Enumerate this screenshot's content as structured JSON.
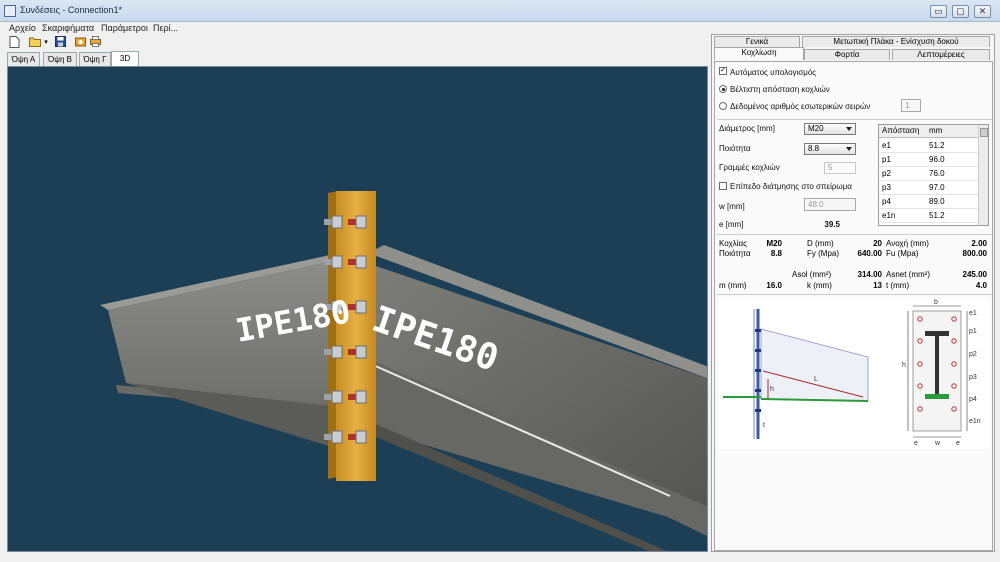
{
  "window": {
    "title": "Συνδέσεις - Connection1*",
    "min": "▭",
    "max": "▢",
    "close": "✕"
  },
  "menu": [
    "Αρχείο",
    "Σκαριφήματα",
    "Παράμετροι",
    "Περί..."
  ],
  "toolbar": {
    "icons": [
      "new-icon",
      "open-icon",
      "save-icon",
      "snapshot-icon",
      "print-icon"
    ]
  },
  "view_tabs": [
    "Όψη Α",
    "Όψη Β",
    "Όψη Γ",
    "3D"
  ],
  "view3d": {
    "beam_label_left": "IPE180",
    "beam_label_right": "IPE180"
  },
  "right_tabs_row1": [
    "Γενικά",
    "Μετωπική Πλάκα - Ενίσχυση δοκού"
  ],
  "right_tabs_row2": [
    "Κοχλίωση",
    "Φορτία",
    "Λεπτομέρειες"
  ],
  "bolting": {
    "auto_calc": "Αυτόματος υπολογισμός",
    "option_optimal": "Βέλτιστη απόσταση κοχλιών",
    "option_given": "Δεδομένος αριθμός εσωτερικών σειρών",
    "given_rows_value": "1",
    "diameter_label": "Διάμετρος [mm]",
    "diameter_value": "M20",
    "quality_label": "Ποιότητα",
    "quality_value": "8.8",
    "rows_label": "Γραμμές κοχλιών",
    "rows_value": "5",
    "threaded_plane": "Επίπεδο διάτμησης στο σπείρωμα",
    "w_label": "w [mm]",
    "w_value": "48.0",
    "e_label": "e [mm]",
    "e_value": "39.5",
    "table_headers": [
      "Απόσταση",
      "mm"
    ],
    "table_rows": [
      [
        "e1",
        "51.2"
      ],
      [
        "p1",
        "96.0"
      ],
      [
        "p2",
        "76.0"
      ],
      [
        "p3",
        "97.0"
      ],
      [
        "p4",
        "89.0"
      ],
      [
        "e1n",
        "51.2"
      ]
    ]
  },
  "results": {
    "bolt_label": "Κοχλίας",
    "bolt_value": "M20",
    "quality_label": "Ποιότητα",
    "quality_value": "8.8",
    "D_label": "D (mm)",
    "D_value": "20",
    "Fy_label": "Fy (Mpa)",
    "Fy_value": "640.00",
    "tol_label": "Ανοχή (mm)",
    "tol_value": "2.00",
    "Fu_label": "Fu (Mpa)",
    "Fu_value": "800.00",
    "Asol_label": "Asol (mm²)",
    "Asol_value": "314.00",
    "Asnet_label": "Asnet (mm²)",
    "Asnet_value": "245.00",
    "m_label": "m (mm)",
    "m_value": "16.0",
    "k_label": "k (mm)",
    "k_value": "13",
    "t_label": "t (mm)",
    "t_value": "4.0"
  },
  "diagram_labels": {
    "left": [
      "L",
      "h",
      "t"
    ],
    "right": [
      "b",
      "e1",
      "p1",
      "p2",
      "p3",
      "p4",
      "e1n",
      "h",
      "e",
      "w",
      "e"
    ]
  },
  "colors": {
    "viewport_bg": "#1d3f55",
    "plate": "#e0a83a",
    "bolt_red": "#b0302a",
    "beam_grey": "#8a8b86"
  }
}
